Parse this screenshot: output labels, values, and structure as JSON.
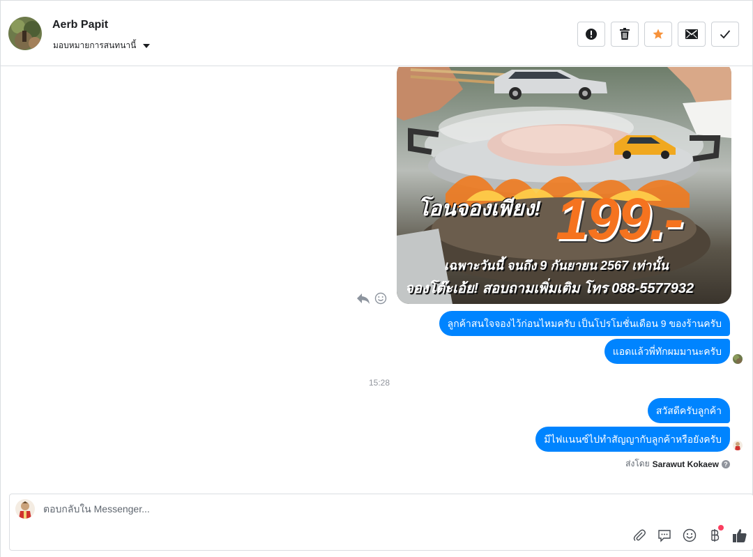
{
  "header": {
    "contact_name": "Aerb Papit",
    "assign_label": "มอบหมายการสนทนานี้"
  },
  "actions": [
    {
      "name": "spam-button",
      "icon": "alert-icon"
    },
    {
      "name": "delete-button",
      "icon": "trash-icon"
    },
    {
      "name": "star-button",
      "icon": "star-icon"
    },
    {
      "name": "mark-unread-button",
      "icon": "envelope-icon"
    },
    {
      "name": "mark-done-button",
      "icon": "check-icon"
    }
  ],
  "image_message": {
    "headline": "โอนจองเพียง!",
    "price": "199.-",
    "line2": "เฉพาะวันนี้ จนถึง 9 กันยายน 2567 เท่านั้น",
    "line3": "จองโต๊ะเอ้ย! สอบถามเพิ่มเติม โทร 088-5577932"
  },
  "messages": [
    {
      "text": "ลูกค้าสนใจจองไว้ก่อนไหมครับ เป็นโปรโมชั่นเดือน 9  ของร้านครับ"
    },
    {
      "text": "แอดแล้วพี่ทักผมมานะครับ"
    },
    {
      "text": "สวัสดีครับลูกค้า"
    },
    {
      "text": "มีไฟแนนซ์ไปทำสัญญากับลูกค้าหรือยังครับ"
    }
  ],
  "timestamp": "15:28",
  "sent_by": {
    "prefix": "ส่งโดย",
    "name": "Sarawut Kokaew"
  },
  "composer": {
    "placeholder": "ตอบกลับใน Messenger..."
  },
  "colors": {
    "bubble": "#0084ff",
    "star": "#f7923a",
    "notification": "#fa3e5f"
  }
}
